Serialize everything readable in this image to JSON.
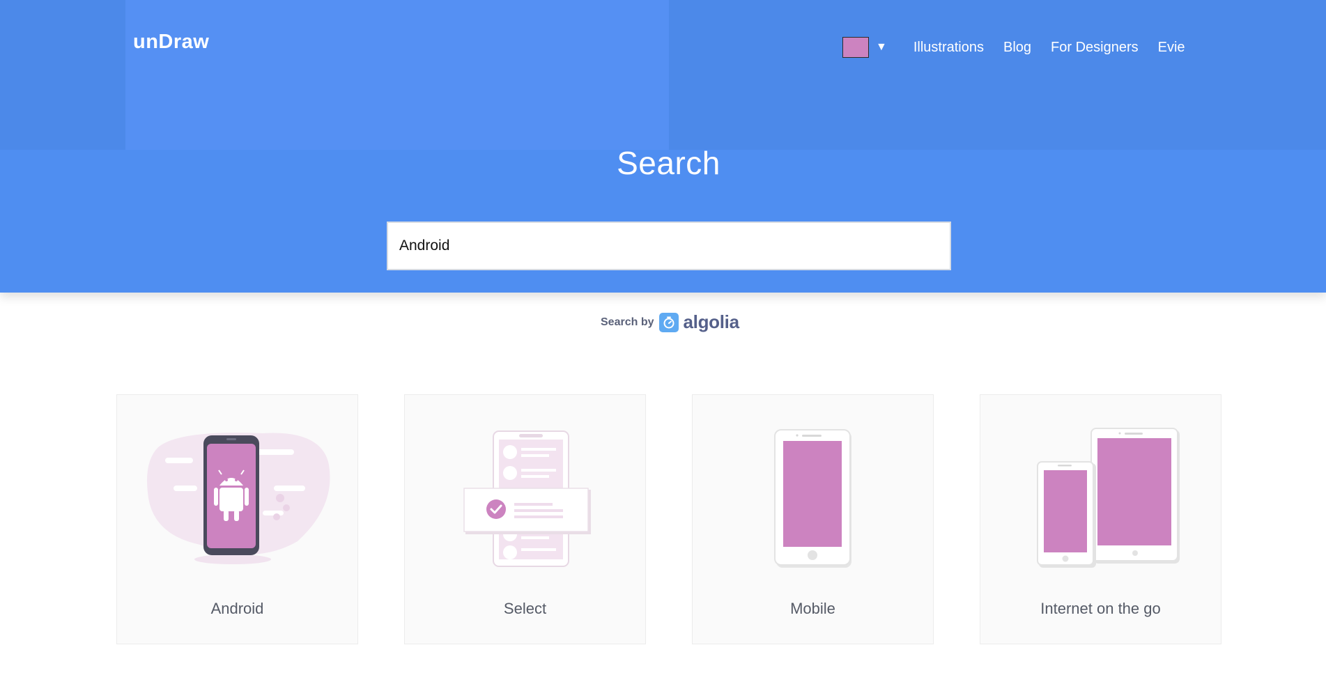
{
  "header": {
    "logo": "unDraw",
    "color_picker": {
      "selected_color": "#cc83c0",
      "caret": "▼"
    },
    "nav": [
      {
        "label": "Illustrations"
      },
      {
        "label": "Blog"
      },
      {
        "label": "For Designers"
      },
      {
        "label": "Evie"
      }
    ]
  },
  "hero": {
    "title": "Search"
  },
  "search": {
    "value": "Android"
  },
  "search_by": {
    "label": "Search by",
    "brand": "algolia"
  },
  "results": [
    {
      "label": "Android",
      "icon": "android-phone-illustration"
    },
    {
      "label": "Select",
      "icon": "select-list-illustration"
    },
    {
      "label": "Mobile",
      "icon": "mobile-phone-illustration"
    },
    {
      "label": "Internet on the go",
      "icon": "tablet-and-phone-illustration"
    }
  ],
  "colors": {
    "hero_blue": "#4f8ef1",
    "accent": "#cc83c0"
  }
}
